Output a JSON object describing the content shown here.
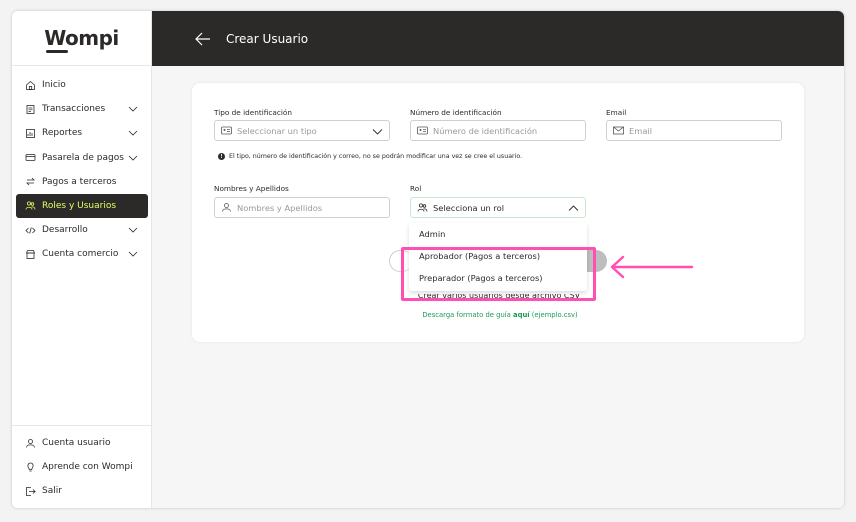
{
  "brand": {
    "logo": "Wompi"
  },
  "header": {
    "title": "Crear Usuario"
  },
  "sidebar": {
    "items": [
      {
        "label": "Inicio",
        "icon": "home-icon",
        "chevron": false
      },
      {
        "label": "Transacciones",
        "icon": "receipt-icon",
        "chevron": true
      },
      {
        "label": "Reportes",
        "icon": "report-icon",
        "chevron": true
      },
      {
        "label": "Pasarela de pagos",
        "icon": "card-icon",
        "chevron": true
      },
      {
        "label": "Pagos a terceros",
        "icon": "transfer-icon",
        "chevron": false
      },
      {
        "label": "Roles y Usuarios",
        "icon": "users-icon",
        "chevron": false,
        "active": true
      },
      {
        "label": "Desarrollo",
        "icon": "code-icon",
        "chevron": true
      },
      {
        "label": "Cuenta comercio",
        "icon": "store-icon",
        "chevron": true
      }
    ],
    "bottom": [
      {
        "label": "Cuenta usuario",
        "icon": "user-icon"
      },
      {
        "label": "Aprende con Wompi",
        "icon": "lightbulb-icon"
      },
      {
        "label": "Salir",
        "icon": "logout-icon"
      }
    ]
  },
  "form": {
    "tipo_label": "Tipo de identificación",
    "tipo_placeholder": "Seleccionar un tipo",
    "numero_label": "Número de identificación",
    "numero_placeholder": "Número de identificación",
    "email_label": "Email",
    "email_placeholder": "Email",
    "info_note": "El tipo, número de identificación y correo, no se podrán modificar una vez se cree el usuario.",
    "nombres_label": "Nombres y Apellidos",
    "nombres_placeholder": "Nombres y Apellidos",
    "rol_label": "Rol",
    "rol_value": "Selecciona un rol",
    "rol_options": [
      "Admin",
      "Aprobador (Pagos a terceros)",
      "Preparador (Pagos a terceros)"
    ],
    "csv_text": "Crear varios usuarios desde archivo CSV",
    "csv_download_prefix": "Descarga formato de guía ",
    "csv_download_link": "aquí",
    "csv_download_suffix": " (ejemplo.csv)"
  },
  "colors": {
    "dark": "#2c2a29",
    "accent": "#dfff61",
    "highlight": "#ff4fb4",
    "link": "#1a9a55"
  }
}
